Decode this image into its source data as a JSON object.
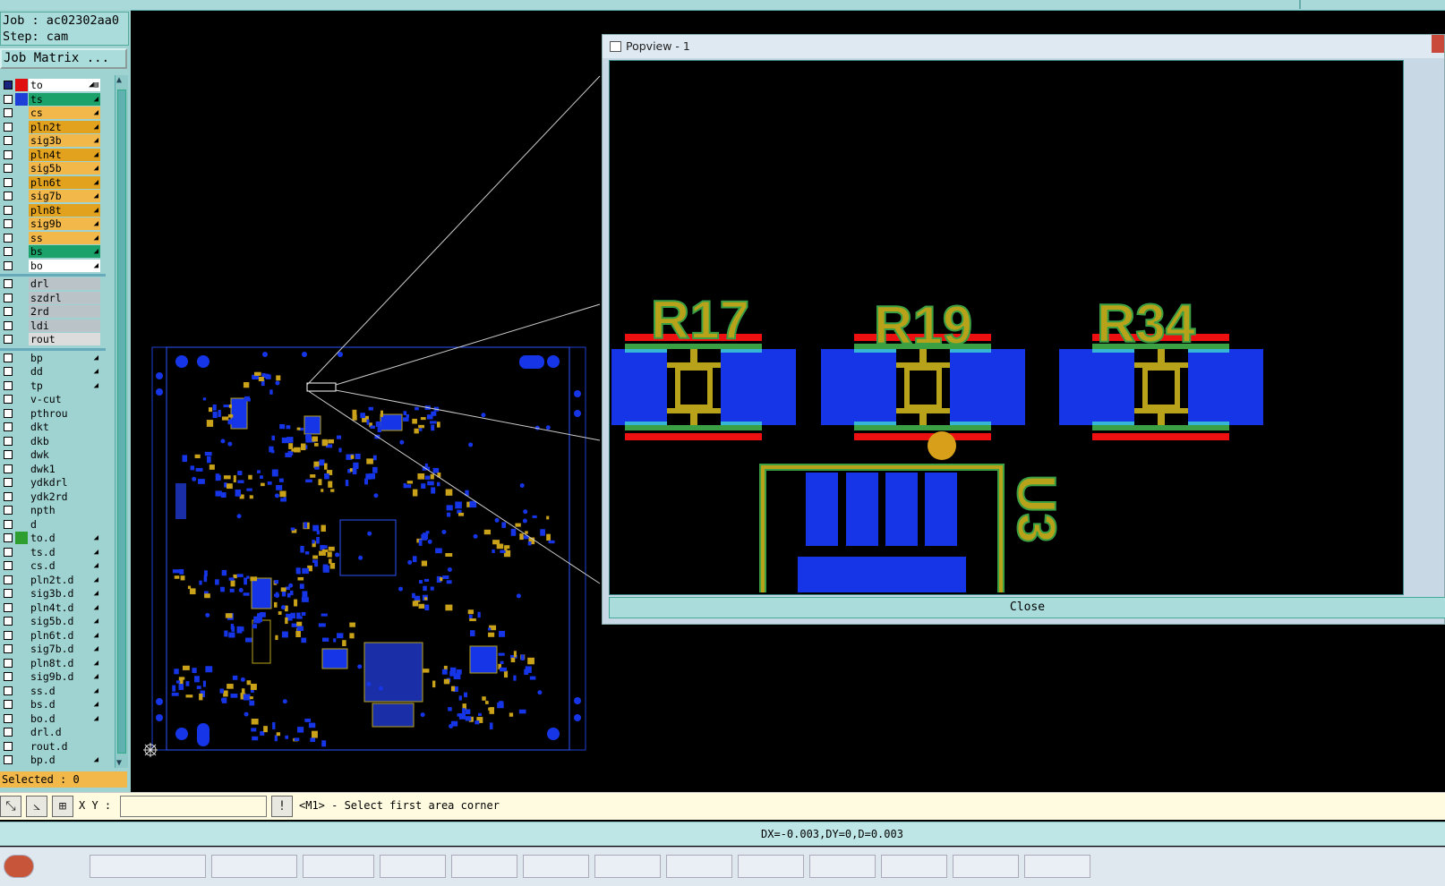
{
  "job": {
    "label": "Job : ac02302aa0",
    "step": "Step: cam",
    "matrix_button": "Job Matrix ..."
  },
  "layers": [
    {
      "name": "to",
      "bg": "#ffffff",
      "checked": true,
      "swatch": "#e01010",
      "arrow": "◢▤"
    },
    {
      "name": "ts",
      "bg": "#1aa26a",
      "checked": false,
      "swatch": "#1d3fd8",
      "arrow": "◢"
    },
    {
      "name": "cs",
      "bg": "#f2b84a",
      "checked": false,
      "swatch": "",
      "arrow": "◢"
    },
    {
      "name": "pln2t",
      "bg": "#e3a21d",
      "checked": false,
      "swatch": "",
      "arrow": "◢"
    },
    {
      "name": "sig3b",
      "bg": "#f2b84a",
      "checked": false,
      "swatch": "",
      "arrow": "◢"
    },
    {
      "name": "pln4t",
      "bg": "#e3a21d",
      "checked": false,
      "swatch": "",
      "arrow": "◢"
    },
    {
      "name": "sig5b",
      "bg": "#f2b84a",
      "checked": false,
      "swatch": "",
      "arrow": "◢"
    },
    {
      "name": "pln6t",
      "bg": "#e3a21d",
      "checked": false,
      "swatch": "",
      "arrow": "◢"
    },
    {
      "name": "sig7b",
      "bg": "#f2b84a",
      "checked": false,
      "swatch": "",
      "arrow": "◢"
    },
    {
      "name": "pln8t",
      "bg": "#e3a21d",
      "checked": false,
      "swatch": "",
      "arrow": "◢"
    },
    {
      "name": "sig9b",
      "bg": "#f2b84a",
      "checked": false,
      "swatch": "",
      "arrow": "◢"
    },
    {
      "name": "ss",
      "bg": "#f2b84a",
      "checked": false,
      "swatch": "",
      "arrow": "◢"
    },
    {
      "name": "bs",
      "bg": "#1aa26a",
      "checked": false,
      "swatch": "",
      "arrow": "◢"
    },
    {
      "name": "bo",
      "bg": "#ffffff",
      "checked": false,
      "swatch": "",
      "arrow": "◢"
    },
    {
      "name": "drl",
      "bg": "#b9c3c8",
      "checked": false,
      "swatch": "",
      "arrow": ""
    },
    {
      "name": "szdrl",
      "bg": "#b9c3c8",
      "checked": false,
      "swatch": "",
      "arrow": ""
    },
    {
      "name": "2rd",
      "bg": "#b9c3c8",
      "checked": false,
      "swatch": "",
      "arrow": ""
    },
    {
      "name": "ldi",
      "bg": "#b9c3c8",
      "checked": false,
      "swatch": "",
      "arrow": ""
    },
    {
      "name": "rout",
      "bg": "#dcdcdc",
      "checked": false,
      "swatch": "",
      "arrow": ""
    },
    {
      "name": "bp",
      "bg": "#9fd3d2",
      "checked": false,
      "swatch": "",
      "arrow": "◢"
    },
    {
      "name": "dd",
      "bg": "#9fd3d2",
      "checked": false,
      "swatch": "",
      "arrow": "◢"
    },
    {
      "name": "tp",
      "bg": "#9fd3d2",
      "checked": false,
      "swatch": "",
      "arrow": "◢"
    },
    {
      "name": "v-cut",
      "bg": "#9fd3d2",
      "checked": false,
      "swatch": "",
      "arrow": ""
    },
    {
      "name": "pthrou",
      "bg": "#9fd3d2",
      "checked": false,
      "swatch": "",
      "arrow": ""
    },
    {
      "name": "dkt",
      "bg": "#9fd3d2",
      "checked": false,
      "swatch": "",
      "arrow": ""
    },
    {
      "name": "dkb",
      "bg": "#9fd3d2",
      "checked": false,
      "swatch": "",
      "arrow": ""
    },
    {
      "name": "dwk",
      "bg": "#9fd3d2",
      "checked": false,
      "swatch": "",
      "arrow": ""
    },
    {
      "name": "dwk1",
      "bg": "#9fd3d2",
      "checked": false,
      "swatch": "",
      "arrow": ""
    },
    {
      "name": "ydkdrl",
      "bg": "#9fd3d2",
      "checked": false,
      "swatch": "",
      "arrow": ""
    },
    {
      "name": "ydk2rd",
      "bg": "#9fd3d2",
      "checked": false,
      "swatch": "",
      "arrow": ""
    },
    {
      "name": "npth",
      "bg": "#9fd3d2",
      "checked": false,
      "swatch": "",
      "arrow": ""
    },
    {
      "name": "d",
      "bg": "#9fd3d2",
      "checked": false,
      "swatch": "",
      "arrow": ""
    },
    {
      "name": "to.d",
      "bg": "#9fd3d2",
      "checked": false,
      "swatch": "#2e9e2e",
      "arrow": "◢"
    },
    {
      "name": "ts.d",
      "bg": "#9fd3d2",
      "checked": false,
      "swatch": "",
      "arrow": "◢"
    },
    {
      "name": "cs.d",
      "bg": "#9fd3d2",
      "checked": false,
      "swatch": "",
      "arrow": "◢"
    },
    {
      "name": "pln2t.d",
      "bg": "#9fd3d2",
      "checked": false,
      "swatch": "",
      "arrow": "◢"
    },
    {
      "name": "sig3b.d",
      "bg": "#9fd3d2",
      "checked": false,
      "swatch": "",
      "arrow": "◢"
    },
    {
      "name": "pln4t.d",
      "bg": "#9fd3d2",
      "checked": false,
      "swatch": "",
      "arrow": "◢"
    },
    {
      "name": "sig5b.d",
      "bg": "#9fd3d2",
      "checked": false,
      "swatch": "",
      "arrow": "◢"
    },
    {
      "name": "pln6t.d",
      "bg": "#9fd3d2",
      "checked": false,
      "swatch": "",
      "arrow": "◢"
    },
    {
      "name": "sig7b.d",
      "bg": "#9fd3d2",
      "checked": false,
      "swatch": "",
      "arrow": "◢"
    },
    {
      "name": "pln8t.d",
      "bg": "#9fd3d2",
      "checked": false,
      "swatch": "",
      "arrow": "◢"
    },
    {
      "name": "sig9b.d",
      "bg": "#9fd3d2",
      "checked": false,
      "swatch": "",
      "arrow": "◢"
    },
    {
      "name": "ss.d",
      "bg": "#9fd3d2",
      "checked": false,
      "swatch": "",
      "arrow": "◢"
    },
    {
      "name": "bs.d",
      "bg": "#9fd3d2",
      "checked": false,
      "swatch": "",
      "arrow": "◢"
    },
    {
      "name": "bo.d",
      "bg": "#9fd3d2",
      "checked": false,
      "swatch": "",
      "arrow": "◢"
    },
    {
      "name": "drl.d",
      "bg": "#9fd3d2",
      "checked": false,
      "swatch": "",
      "arrow": ""
    },
    {
      "name": "rout.d",
      "bg": "#9fd3d2",
      "checked": false,
      "swatch": "",
      "arrow": ""
    },
    {
      "name": "bp.d",
      "bg": "#9fd3d2",
      "checked": false,
      "swatch": "",
      "arrow": "◢"
    }
  ],
  "selected": "Selected : 0",
  "popview": {
    "title": "Popview - 1",
    "close_label": "Close",
    "refdes": [
      "R17",
      "R19",
      "R34",
      "U3"
    ]
  },
  "command": {
    "xy_label": "X Y :",
    "xy_value": "",
    "message": "<M1> - Select first area corner"
  },
  "status": {
    "readout": "DX=-0.003,DY=0,D=0.003"
  },
  "colors": {
    "pad": "#1535e6",
    "silk": "#b8a21a",
    "mask": "#3aa043",
    "red": "#ee1010",
    "panel": "#9fd3d2",
    "selected": "#f2b84a"
  },
  "icons": [
    "toolbar-zoom-icon",
    "toolbar-measure-icon",
    "toolbar-grid-icon",
    "snap-icon",
    "crosshair-icon"
  ]
}
